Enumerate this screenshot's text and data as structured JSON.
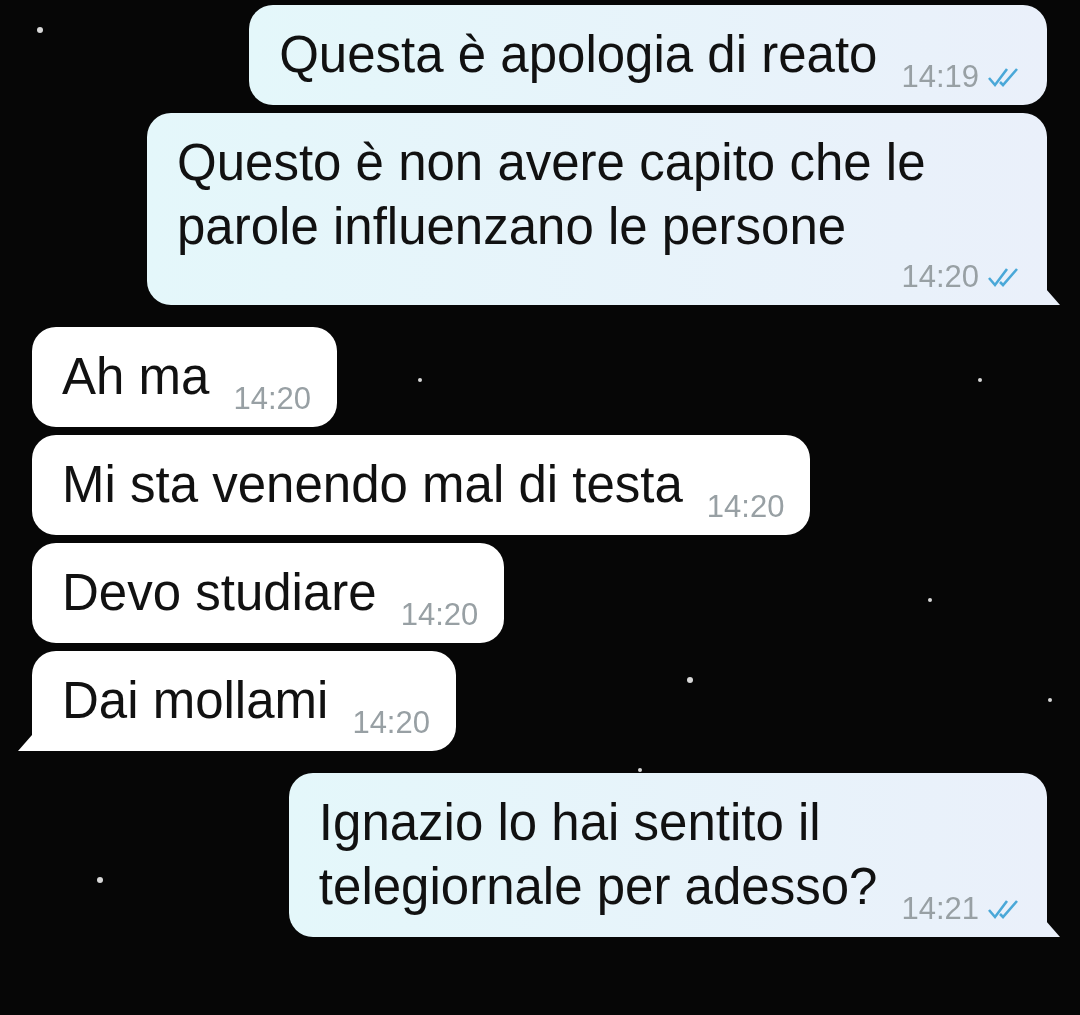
{
  "messages": [
    {
      "kind": "out",
      "text": "Questa è apologia di reato",
      "time": "14:19",
      "read": true,
      "tail": false
    },
    {
      "kind": "out",
      "text": "Questo è non avere capito che le\nparole influenzano le persone",
      "time": "14:20",
      "read": true,
      "tail": true
    },
    {
      "kind": "in",
      "text": "Ah ma",
      "time": "14:20",
      "tail": false
    },
    {
      "kind": "in",
      "text": "Mi sta venendo mal di testa",
      "time": "14:20",
      "tail": false
    },
    {
      "kind": "in",
      "text": "Devo studiare",
      "time": "14:20",
      "tail": false
    },
    {
      "kind": "in",
      "text": "Dai mollami",
      "time": "14:20",
      "tail": true
    },
    {
      "kind": "out",
      "text": "Ignazio lo hai sentito il\ntelegiornale per adesso?",
      "time": "14:21",
      "read": true,
      "tail": true
    }
  ]
}
